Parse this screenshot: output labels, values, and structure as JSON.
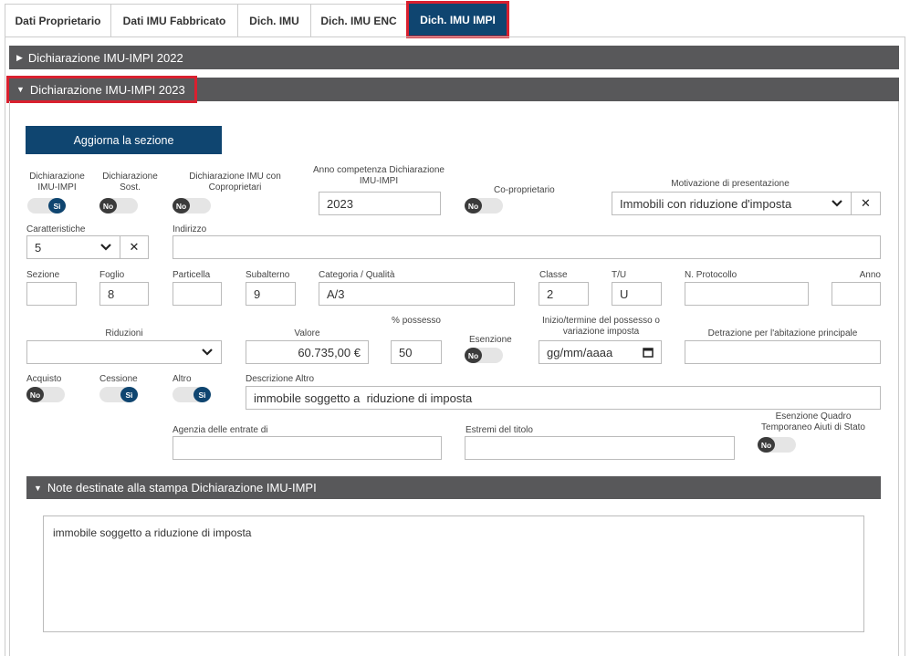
{
  "tabs": [
    {
      "label": "Dati Proprietario"
    },
    {
      "label": "Dati IMU Fabbricato"
    },
    {
      "label": "Dich. IMU"
    },
    {
      "label": "Dich. IMU ENC"
    },
    {
      "label": "Dich. IMU IMPI"
    }
  ],
  "accordions": {
    "y2022": "Dichiarazione IMU-IMPI 2022",
    "y2023": "Dichiarazione IMU-IMPI 2023"
  },
  "update_button": "Aggiorna la sezione",
  "row1": {
    "dich_imu_impi_label": "Dichiarazione IMU-IMPI",
    "dich_imu_impi_value": "Sì",
    "dich_sost_label": "Dichiarazione Sost.",
    "dich_sost_value": "No",
    "dich_copropr_label": "Dichiarazione IMU con Coproprietari",
    "dich_copropr_value": "No",
    "anno_label": "Anno competenza Dichiarazione IMU-IMPI",
    "anno_value": "2023",
    "coproprietario_label": "Co-proprietario",
    "coproprietario_value": "No",
    "motivazione_label": "Motivazione di presentazione",
    "motivazione_value": "Immobili con riduzione d'imposta"
  },
  "row2": {
    "caratteristiche_label": "Caratteristiche",
    "caratteristiche_value": "5",
    "indirizzo_label": "Indirizzo",
    "indirizzo_value": ""
  },
  "row3": {
    "sezione_label": "Sezione",
    "sezione_value": "",
    "foglio_label": "Foglio",
    "foglio_value": "8",
    "particella_label": "Particella",
    "particella_value": "",
    "subalterno_label": "Subalterno",
    "subalterno_value": "9",
    "categoria_label": "Categoria / Qualità",
    "categoria_value": "A/3",
    "classe_label": "Classe",
    "classe_value": "2",
    "tu_label": "T/U",
    "tu_value": "U",
    "protocollo_label": "N. Protocollo",
    "protocollo_value": "",
    "anno_label": "Anno",
    "anno_value": ""
  },
  "row4": {
    "riduzioni_label": "Riduzioni",
    "riduzioni_value": "",
    "valore_label": "Valore",
    "valore_value": "60.735,00 €",
    "possesso_label": "% possesso",
    "possesso_value": "50",
    "esenzione_label": "Esenzione",
    "esenzione_value": "No",
    "inizio_label": "Inizio/termine del possesso o variazione imposta",
    "inizio_placeholder": "gg/mm/aaaa",
    "detrazione_label": "Detrazione per l'abitazione principale",
    "detrazione_value": ""
  },
  "row5": {
    "acquisto_label": "Acquisto",
    "acquisto_value": "No",
    "cessione_label": "Cessione",
    "cessione_value": "Sì",
    "altro_label": "Altro",
    "altro_value": "Sì",
    "descrizione_label": "Descrizione Altro",
    "descrizione_value": "immobile soggetto a  riduzione di imposta"
  },
  "row6": {
    "agenzia_label": "Agenzia delle entrate di",
    "agenzia_value": "",
    "estremi_label": "Estremi del titolo",
    "estremi_value": "",
    "esenzione_quadro_label": "Esenzione Quadro Temporaneo Aiuti di Stato",
    "esenzione_quadro_value": "No"
  },
  "note": {
    "title": "Note destinate alla stampa Dichiarazione IMU-IMPI",
    "text": "immobile soggetto a riduzione di imposta"
  },
  "colors": {
    "primary": "#0f4570",
    "bar": "#58585a",
    "highlight": "#d9202f"
  }
}
